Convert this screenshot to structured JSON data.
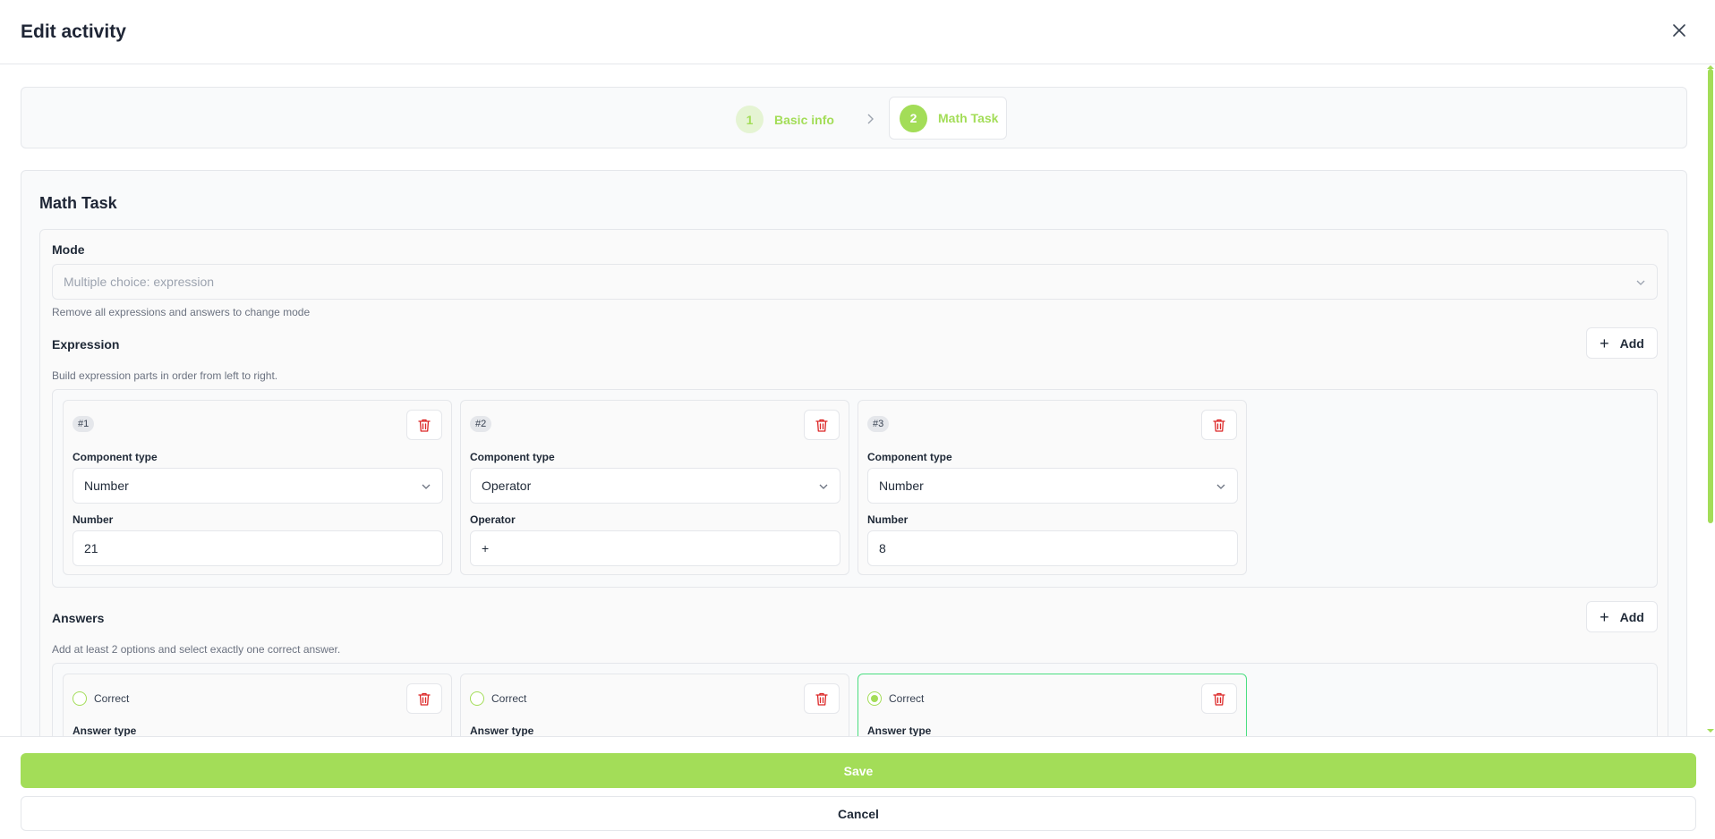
{
  "dialog": {
    "title": "Edit activity"
  },
  "stepper": {
    "steps": [
      {
        "number": "1",
        "label": "Basic info"
      },
      {
        "number": "2",
        "label": "Math Task"
      }
    ]
  },
  "panel": {
    "title": "Math Task",
    "mode": {
      "label": "Mode",
      "value": "Multiple choice: expression",
      "hint": "Remove all expressions and answers to change mode"
    },
    "expression": {
      "title": "Expression",
      "add_label": "Add",
      "hint": "Build expression parts in order from left to right.",
      "components": [
        {
          "badge": "#1",
          "type_label": "Component type",
          "type": "Number",
          "value_label": "Number",
          "value": "21"
        },
        {
          "badge": "#2",
          "type_label": "Component type",
          "type": "Operator",
          "value_label": "Operator",
          "value": "+"
        },
        {
          "badge": "#3",
          "type_label": "Component type",
          "type": "Number",
          "value_label": "Number",
          "value": "8"
        }
      ]
    },
    "answers": {
      "title": "Answers",
      "add_label": "Add",
      "hint": "Add at least 2 options and select exactly one correct answer.",
      "items": [
        {
          "correct_label": "Correct",
          "checked": false,
          "type_label": "Answer type"
        },
        {
          "correct_label": "Correct",
          "checked": false,
          "type_label": "Answer type"
        },
        {
          "correct_label": "Correct",
          "checked": true,
          "type_label": "Answer type"
        }
      ]
    }
  },
  "footer": {
    "save_label": "Save",
    "cancel_label": "Cancel"
  },
  "colors": {
    "accent": "#a3dd58",
    "accent_light": "#e5f4d3",
    "danger": "#dc2626",
    "selected_border": "#4ade80"
  }
}
